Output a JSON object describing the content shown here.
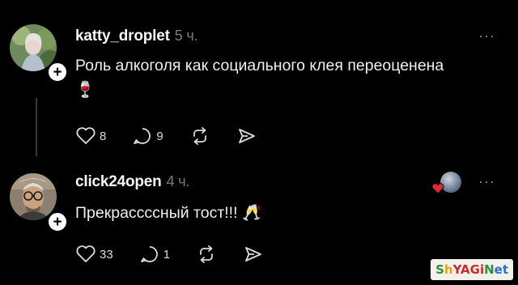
{
  "posts": [
    {
      "username": "katty_droplet",
      "time": "5 ч.",
      "text": "Роль алкоголя как социального клея переоцененa",
      "emoji": "🍷",
      "likes": "8",
      "replies": "9",
      "more": "···"
    },
    {
      "username": "click24open",
      "time": "4 ч.",
      "text": "Прекрассссный тост!!!",
      "emoji": "🥂",
      "likes": "33",
      "replies": "1",
      "more": "···"
    }
  ],
  "follow_symbol": "+",
  "watermark": {
    "parts": [
      "S",
      "h",
      "YAGi",
      "N",
      "et"
    ],
    "colors": [
      "#2d8f3c",
      "#e0a21a",
      "#c82b2b",
      "#2d8f3c",
      "#2a6fcf"
    ]
  },
  "colors": {
    "background": "#000000",
    "text": "#f0f0f0",
    "muted": "#7a7a7a",
    "heart": "#e0263c"
  }
}
